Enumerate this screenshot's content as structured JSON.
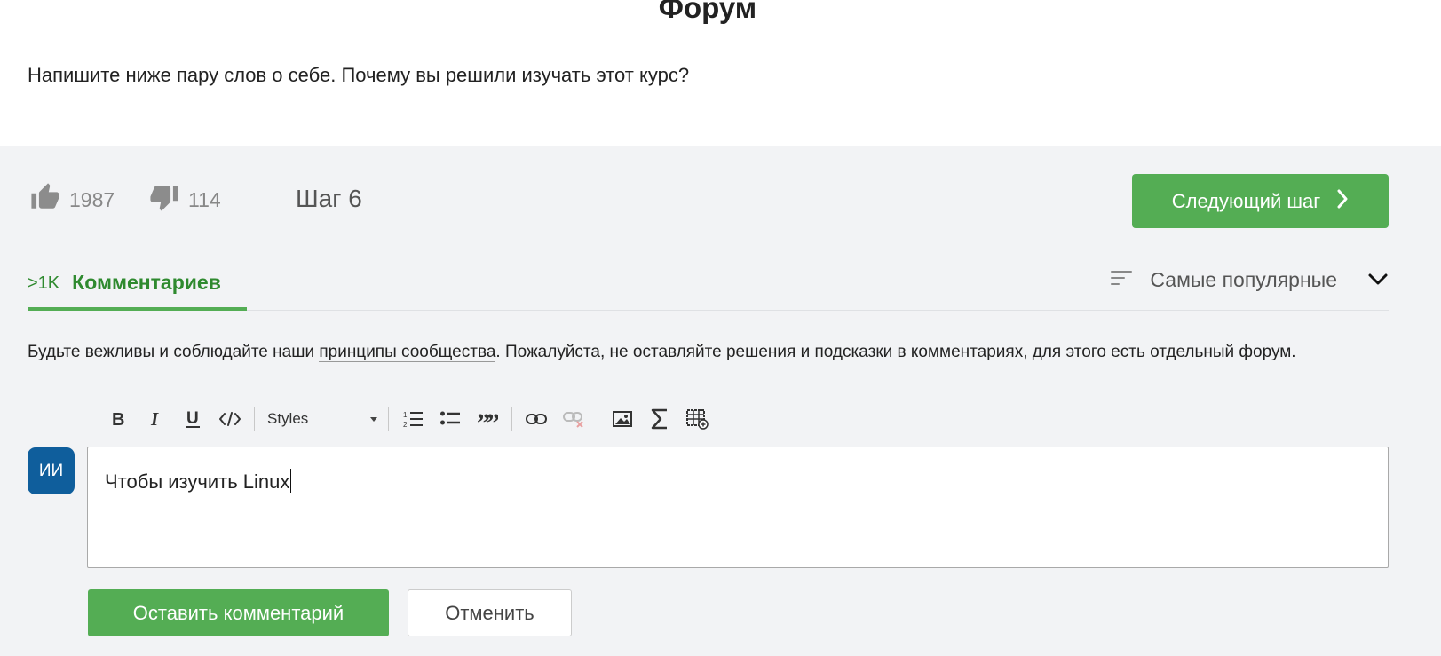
{
  "page": {
    "title": "Форум",
    "question": "Напишите ниже пару слов о себе. Почему вы решили изучать этот курс?"
  },
  "step": {
    "likes": "1987",
    "dislikes": "114",
    "label": "Шаг 6",
    "next_label": "Следующий шаг"
  },
  "comments": {
    "count": ">1K",
    "tab_label": "Комментариев",
    "sort_label": "Самые популярные",
    "rules_before": "Будьте вежливы и соблюдайте наши ",
    "rules_link": "принципы сообщества",
    "rules_after": ". Пожалуйста, не оставляйте решения и подсказки в комментариях, для этого есть отдельный форум."
  },
  "editor": {
    "styles_label": "Styles",
    "avatar_initials": "ИИ",
    "text": "Чтобы изучить Linux",
    "submit_label": "Оставить комментарий",
    "cancel_label": "Отменить"
  },
  "colors": {
    "accent_green": "#54ad54",
    "tab_green": "#2f8a2f",
    "avatar_blue": "#0f5e9c"
  }
}
